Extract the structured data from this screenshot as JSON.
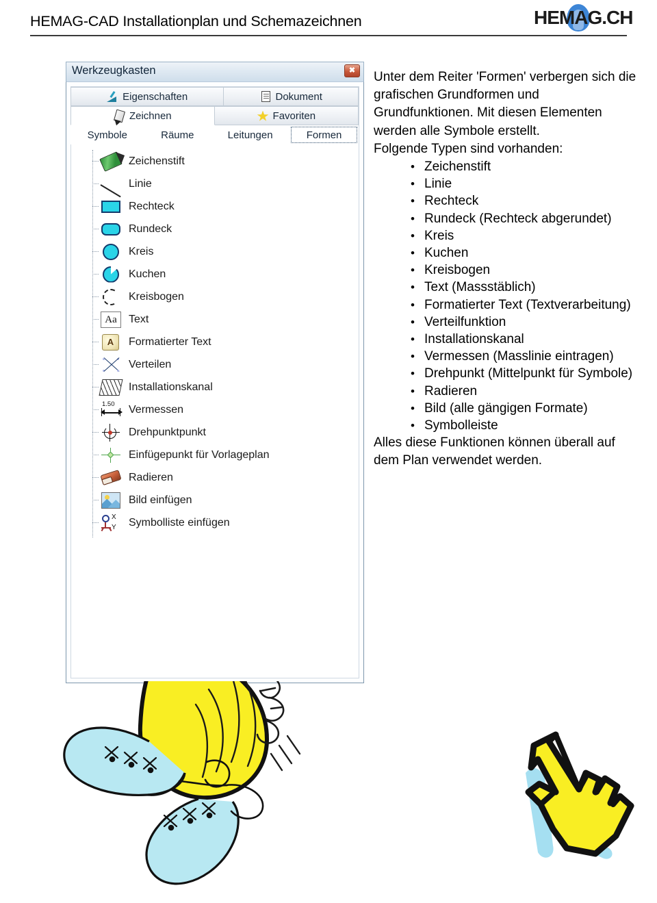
{
  "header": {
    "title": "HEMAG-CAD Installationplan und Schemazeichnen",
    "logo_text": "HEMAG.CH",
    "logo_accent_color": "#3d85d6"
  },
  "toolbox_window": {
    "title": "Werkzeugkasten",
    "close_label": "✖",
    "tab_rows": [
      [
        {
          "label": "Eigenschaften",
          "icon": "properties-pen-icon",
          "state": "normal"
        },
        {
          "label": "Dokument",
          "icon": "document-icon",
          "state": "normal"
        }
      ],
      [
        {
          "label": "Zeichnen",
          "icon": "pencil-icon",
          "state": "selected"
        },
        {
          "label": "Favoriten",
          "icon": "star-icon",
          "state": "normal"
        }
      ]
    ],
    "sub_tabs": [
      {
        "label": "Symbole",
        "state": "normal"
      },
      {
        "label": "Räume",
        "state": "normal"
      },
      {
        "label": "Leitungen",
        "state": "normal"
      },
      {
        "label": "Formen",
        "state": "focused"
      }
    ],
    "tools": [
      {
        "label": "Zeichenstift",
        "icon": "pencil-tool-icon"
      },
      {
        "label": "Linie",
        "icon": "line-tool-icon"
      },
      {
        "label": "Rechteck",
        "icon": "rectangle-tool-icon"
      },
      {
        "label": "Rundeck",
        "icon": "rounded-rectangle-tool-icon"
      },
      {
        "label": "Kreis",
        "icon": "circle-tool-icon"
      },
      {
        "label": "Kuchen",
        "icon": "pie-tool-icon"
      },
      {
        "label": "Kreisbogen",
        "icon": "arc-tool-icon"
      },
      {
        "label": "Text",
        "icon": "text-tool-icon",
        "glyph": "Aa"
      },
      {
        "label": "Formatierter Text",
        "icon": "formatted-text-tool-icon",
        "glyph": "A"
      },
      {
        "label": "Verteilen",
        "icon": "distribute-tool-icon"
      },
      {
        "label": "Installationskanal",
        "icon": "installation-duct-tool-icon"
      },
      {
        "label": "Vermessen",
        "icon": "measure-tool-icon",
        "glyph": "1.50"
      },
      {
        "label": "Drehpunktpunkt",
        "icon": "pivot-point-tool-icon"
      },
      {
        "label": "Einfügepunkt für Vorlageplan",
        "icon": "insert-point-tool-icon"
      },
      {
        "label": "Radieren",
        "icon": "eraser-tool-icon"
      },
      {
        "label": "Bild einfügen",
        "icon": "insert-image-tool-icon"
      },
      {
        "label": "Symbolliste einfügen",
        "icon": "insert-symbol-list-tool-icon"
      }
    ],
    "shape_fill_color": "#2ad4e8",
    "shape_stroke_color": "#123a6b"
  },
  "text_block": {
    "intro": "Unter dem Reiter 'Formen' verbergen sich die grafischen Grundformen und Grundfunktionen. Mit diesen Elementen werden alle Symbole erstellt.",
    "types_lead": "Folgende Typen sind vorhanden:",
    "types": [
      "Zeichenstift",
      "Linie",
      "Rechteck",
      "Rundeck (Rechteck abgerundet)",
      "Kreis",
      "Kuchen",
      "Kreisbogen",
      "Text (Massstäblich)",
      "Formatierter Text (Textverarbeitung)",
      "Verteilfunktion",
      "Installationskanal",
      "Vermessen (Masslinie eintragen)",
      "Drehpunkt (Mittelpunkt für Symbole)",
      "Radieren",
      "Bild (alle gängigen Formate)",
      "Symbolleiste"
    ],
    "outro": "Alles diese Funktionen können überall auf dem Plan verwendet werden."
  },
  "doodle": {
    "sketch_name": "hand-drawn-bee-sketch",
    "cursor_name": "hand-drawn-pointer-cursor",
    "yellow": "#f9ee23",
    "cyan": "#a8e6f2"
  }
}
